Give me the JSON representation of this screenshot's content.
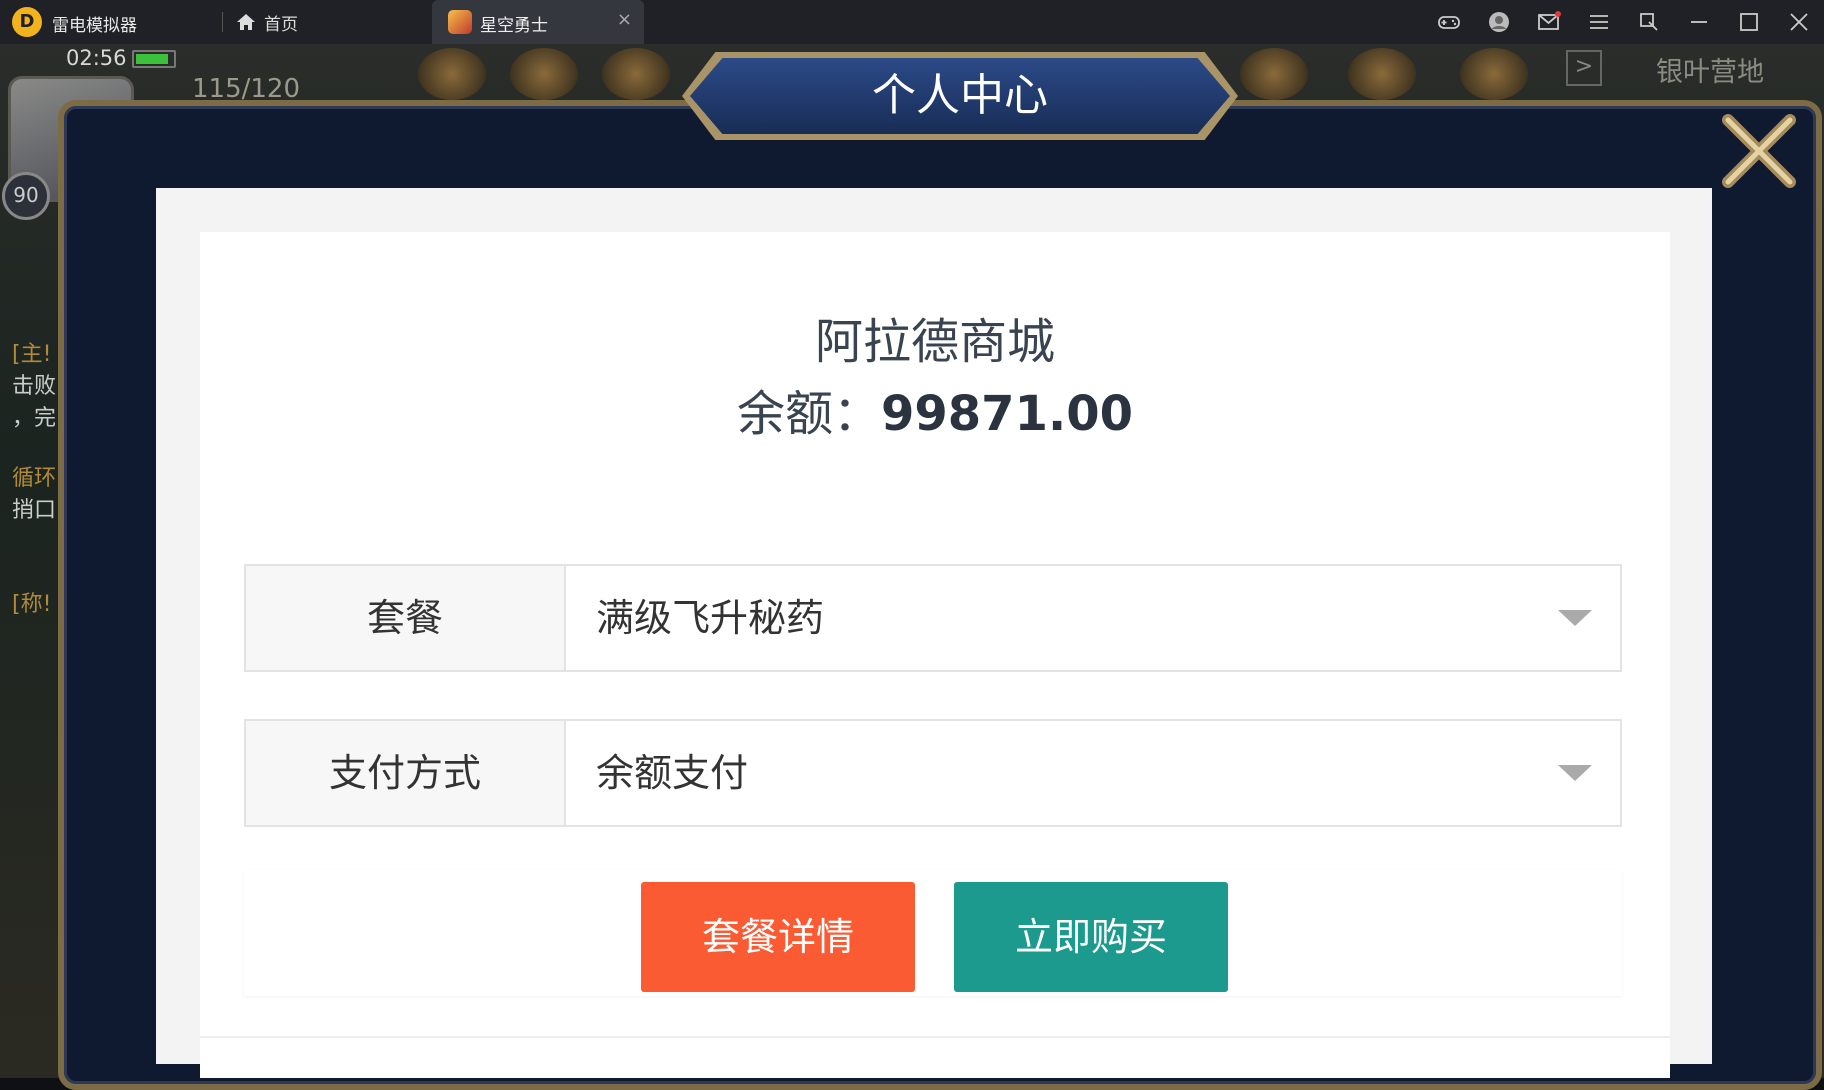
{
  "titlebar": {
    "app_name": "雷电模拟器",
    "home_tab": "首页",
    "game_tab": "星空勇士",
    "close_tab_glyph": "×",
    "window_buttons": [
      "gamepad-icon",
      "account-icon",
      "mail-icon",
      "menu-icon",
      "screenshot-icon",
      "minimize-icon",
      "maximize-icon",
      "close-icon"
    ]
  },
  "hud": {
    "time": "02:56",
    "battery_level": 0.9,
    "energy": "115/120",
    "level": "90",
    "camp": "银叶营地",
    "side_texts": [
      "[主!",
      "击败",
      "，完",
      "循环",
      "捎口",
      "[称!"
    ]
  },
  "modal": {
    "title": "个人中心"
  },
  "shop": {
    "name": "阿拉德商城",
    "balance_label": "余额：",
    "balance_value": "99871.00",
    "package": {
      "label": "套餐",
      "selected": "满级飞升秘药"
    },
    "payment": {
      "label": "支付方式",
      "selected": "余额支付"
    },
    "detail_button": "套餐详情",
    "buy_button": "立即购买"
  },
  "colors": {
    "titlebar_bg": "#1f2126",
    "modal_bg": "#0f1a30",
    "modal_frame": "#7d6b45",
    "detail_button": "#fa5b33",
    "buy_button": "#1b9a8d"
  }
}
